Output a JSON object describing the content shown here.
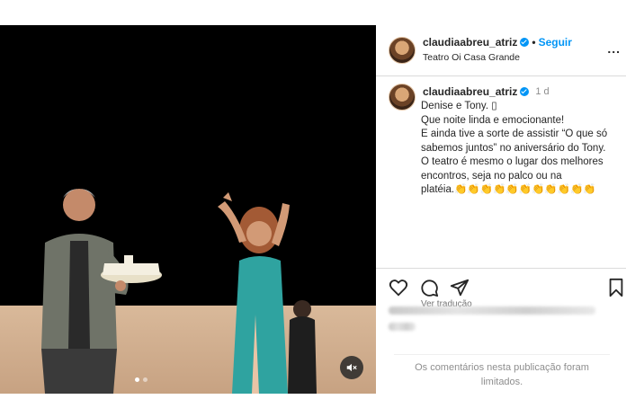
{
  "post": {
    "username": "claudiaabreu_atriz",
    "follow_label": "Seguir",
    "separator": "•",
    "location": "Teatro Oi Casa Grande",
    "more_label": "...",
    "caption": {
      "username": "claudiaabreu_atriz",
      "time": "1 d",
      "lines": [
        "Denise e Tony. ▯",
        "Que noite linda e emocionante!",
        "E ainda tive a sorte de assistir “O que só sabemos juntos” no aniversário do Tony.",
        "O teatro é mesmo o lugar dos melhores encontros, seja no palco ou na",
        "platéia.👏👏👏👏👏👏👏👏👏👏👏"
      ]
    },
    "see_translation": "Ver tradução",
    "comments_limited": "Os comentários nesta publicação foram limitados."
  },
  "media": {
    "carousel_count": 2,
    "carousel_active": 1,
    "mute_icon": "speaker-muted-icon"
  },
  "actions": {
    "icons": [
      "heart-icon",
      "comment-icon",
      "share-icon",
      "bookmark-icon"
    ]
  },
  "colors": {
    "accent": "#0095f6",
    "dress": "#2fa3a0",
    "floor": "#d2ae8c"
  }
}
